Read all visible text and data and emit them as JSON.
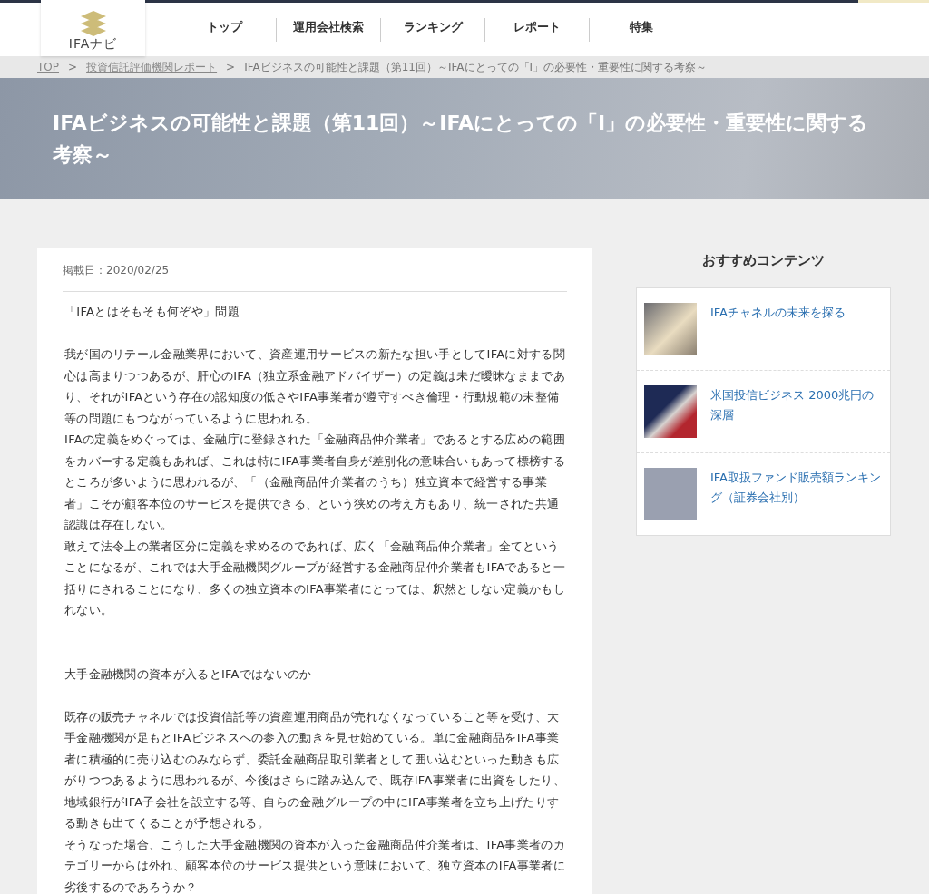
{
  "header": {
    "logo_text": "IFAナビ",
    "nav": [
      {
        "label": "トップ"
      },
      {
        "label": "運用会社検索"
      },
      {
        "label": "ランキング"
      },
      {
        "label": "レポート"
      },
      {
        "label": "特集"
      }
    ]
  },
  "breadcrumb": [
    {
      "label": "TOP",
      "link": true
    },
    {
      "label": "投資信託評価機関レポート",
      "link": true
    },
    {
      "label": "IFAビジネスの可能性と課題（第11回）～IFAにとっての「I」の必要性・重要性に関する考察～",
      "link": false
    }
  ],
  "breadcrumb_separator": ">",
  "hero": {
    "title": "IFAビジネスの可能性と課題（第11回）～IFAにとっての「I」の必要性・重要性に関する考察～"
  },
  "article": {
    "date": "掲載日：2020/02/25",
    "blocks": [
      {
        "kind": "heading",
        "text": "「IFAとはそもそも何ぞや」問題"
      },
      {
        "kind": "paragraph",
        "text": "我が国のリテール金融業界において、資産運用サービスの新たな担い手としてIFAに対する関心は高まりつつあるが、肝心のIFA（独立系金融アドバイザー）の定義は未だ曖昧なままであり、それがIFAという存在の認知度の低さやIFA事業者が遵守すべき倫理・行動規範の未整備等の問題にもつながっているように思われる。"
      },
      {
        "kind": "paragraph",
        "text": "IFAの定義をめぐっては、金融庁に登録された「金融商品仲介業者」であるとする広めの範囲をカバーする定義もあれば、これは特にIFA事業者自身が差別化の意味合いもあって標榜するところが多いように思われるが、「（金融商品仲介業者のうち）独立資本で経営する事業者」こそが顧客本位のサービスを提供できる、という狭めの考え方もあり、統一された共通認識は存在しない。"
      },
      {
        "kind": "paragraph",
        "text": "敢えて法令上の業者区分に定義を求めるのであれば、広く「金融商品仲介業者」全てということになるが、これでは大手金融機関グループが経営する金融商品仲介業者もIFAであると一括りにされることになり、多くの独立資本のIFA事業者にとっては、釈然としない定義かもしれない。"
      },
      {
        "kind": "heading",
        "text": "大手金融機関の資本が入るとIFAではないのか"
      },
      {
        "kind": "paragraph",
        "text": "既存の販売チャネルでは投資信託等の資産運用商品が売れなくなっていること等を受け、大手金融機関が足もとIFAビジネスへの参入の動きを見せ始めている。単に金融商品をIFA事業者に積極的に売り込むのみならず、委託金融商品取引業者として囲い込むといった動きも広がりつつあるように思われるが、今後はさらに踏み込んで、既存IFA事業者に出資をしたり、地域銀行がIFA子会社を設立する等、自らの金融グループの中にIFA事業者を立ち上げたりする動きも出てくることが予想される。"
      },
      {
        "kind": "paragraph",
        "text": "そうなった場合、こうした大手金融機関の資本が入った金融商品仲介業者は、IFA事業者のカテゴリーからは外れ、顧客本位のサービス提供という意味において、独立資本のIFA事業者に劣後するのであろうか？"
      }
    ]
  },
  "sidebar": {
    "title": "おすすめコンテンツ",
    "items": [
      {
        "title": "IFAチャネルの未来を探る"
      },
      {
        "title": "米国投信ビジネス 2000兆円の深層"
      },
      {
        "title": "IFA取扱ファンド販売額ランキング（証券会社別）"
      }
    ]
  }
}
